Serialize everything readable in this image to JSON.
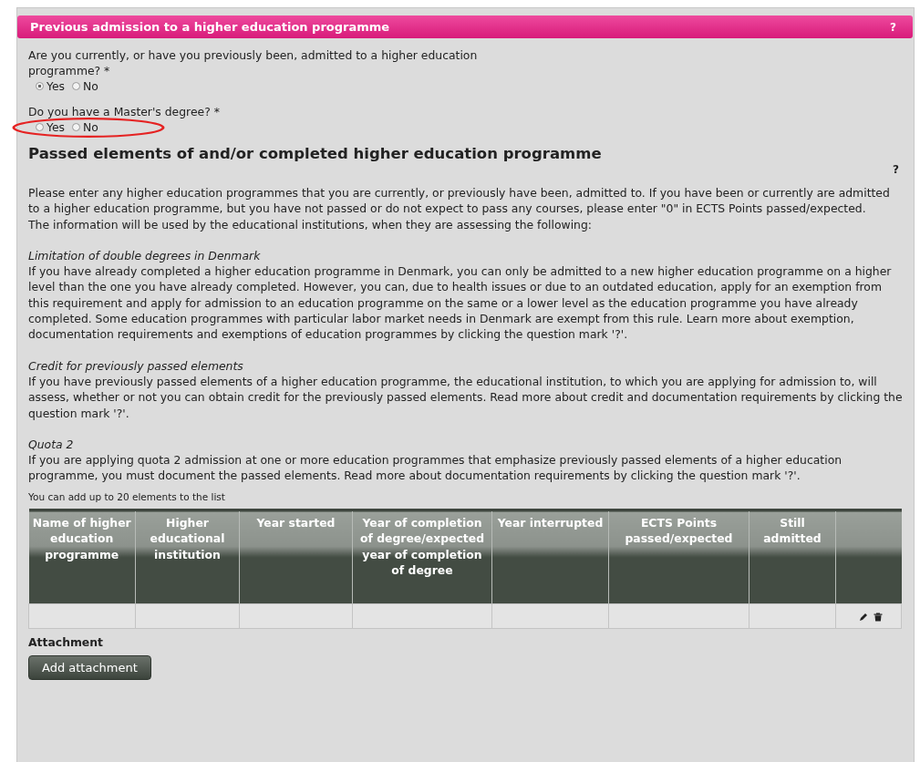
{
  "header": {
    "title": "Previous admission to a higher education programme",
    "help": "?"
  },
  "questions": [
    {
      "label": "Are you currently, or have you previously been, admitted to a higher education programme? *",
      "highlight": false,
      "options": [
        {
          "label": "Yes",
          "selected": true
        },
        {
          "label": "No",
          "selected": false
        }
      ]
    },
    {
      "label": "Do you have a Master's degree? *",
      "highlight": true,
      "options": [
        {
          "label": "Yes",
          "selected": false
        },
        {
          "label": "No",
          "selected": false
        }
      ]
    }
  ],
  "section": {
    "title": "Passed elements of and/or completed higher education programme",
    "help": "?",
    "intro": [
      "Please enter any higher education programmes that you are currently, or previously have been, admitted to. If you have been or currently are admitted to a higher education programme, but you have not passed or do not expect to pass any courses, please enter \"0\" in ECTS Points passed/expected.",
      "The information will be used by the educational institutions, when they are assessing the following:"
    ],
    "blocks": [
      {
        "heading": "Limitation of double degrees in Denmark",
        "text": "If you have already completed a higher education programme in Denmark, you can only be admitted to a new higher education programme on a higher level than the one you have already completed. However, you can, due to health issues or due to an outdated education, apply for an exemption from this requirement and apply for admission to an education programme on the same or a lower level as the education programme you have already completed. Some education programmes with particular labor market needs in Denmark are exempt from this rule. Learn more about exemption, documentation requirements and exemptions of education programmes by clicking the question mark '?'."
      },
      {
        "heading": "Credit for previously passed elements",
        "text": "If you have previously passed elements of a higher education programme, the educational institution, to which you are applying for admission to, will assess, whether or not you can obtain credit for the previously passed elements. Read more about credit and documentation requirements by clicking the question mark '?'."
      },
      {
        "heading": "Quota 2",
        "text": "If you are applying quota 2 admission at one or more education programmes that emphasize previously passed elements of a higher education programme, you must document the passed elements. Read more about documentation requirements by clicking the question mark '?'."
      }
    ],
    "note": "You can add up to 20 elements to the list",
    "table": {
      "columns": [
        "Name of higher education programme",
        "Higher educational institution",
        "Year started",
        "Year of completion of degree/expected year of completion of degree",
        "Year interrupted",
        "ECTS Points passed/expected",
        "Still admitted"
      ]
    },
    "attachment_label": "Attachment",
    "attachment_button": "Add attachment"
  }
}
